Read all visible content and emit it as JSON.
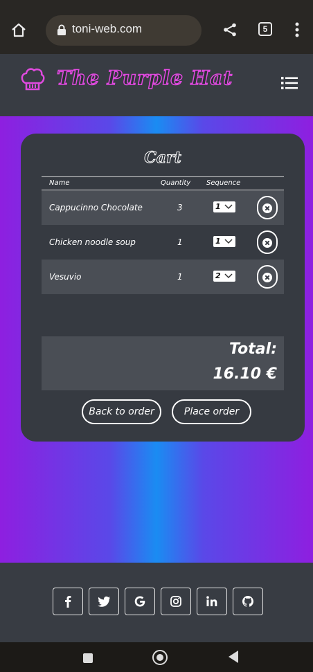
{
  "browser": {
    "url": "toni-web.com",
    "tab_count": "5"
  },
  "header": {
    "brand": "The Purple Hat",
    "brand_color": "#e04adf"
  },
  "cart": {
    "title": "Cart",
    "columns": [
      "Name",
      "Quantity",
      "Sequence"
    ],
    "items": [
      {
        "name": "Cappucinno Chocolate",
        "quantity": "3",
        "sequence": "1"
      },
      {
        "name": "Chicken noodle soup",
        "quantity": "1",
        "sequence": "1"
      },
      {
        "name": "Vesuvio",
        "quantity": "1",
        "sequence": "2"
      }
    ],
    "total_label": "Total:",
    "total_value": "16.10 €",
    "back_button": "Back to order",
    "place_button": "Place order"
  },
  "footer": {
    "social_icons": [
      "facebook-icon",
      "twitter-icon",
      "google-icon",
      "instagram-icon",
      "linkedin-icon",
      "github-icon"
    ]
  },
  "colors": {
    "gradient_purple": "#8e1fe0",
    "gradient_blue": "#1a8cf2",
    "card": "#363a41"
  }
}
